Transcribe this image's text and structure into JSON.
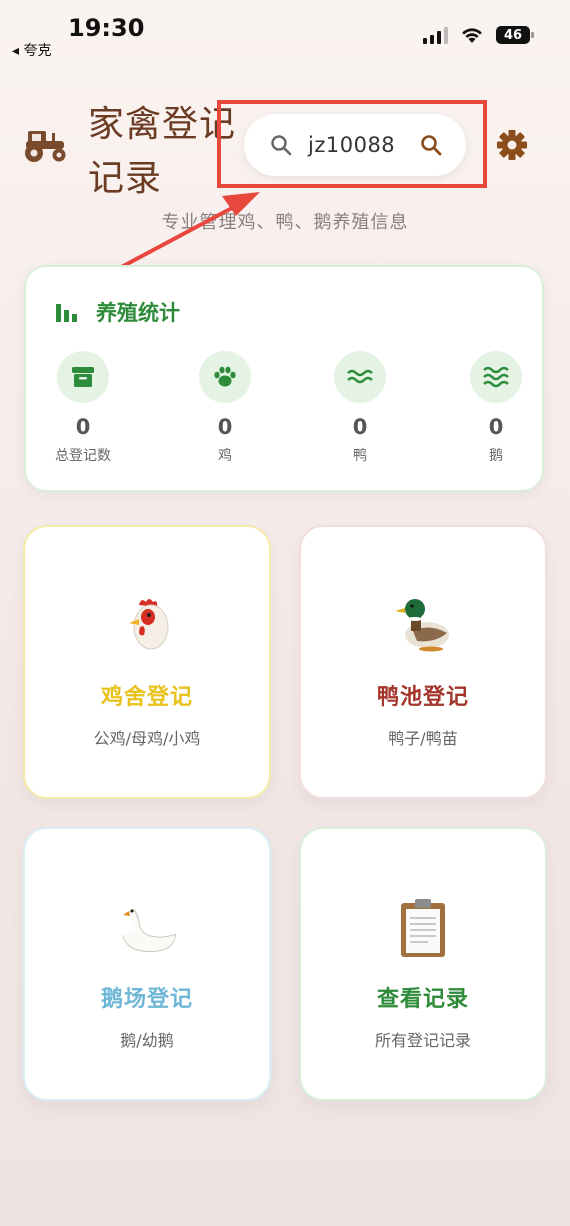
{
  "status": {
    "time": "19:30",
    "back_label": "◂ 夸克",
    "battery": "46"
  },
  "header": {
    "title": "家禽登记记录",
    "subtitle": "专业管理鸡、鸭、鹅养殖信息"
  },
  "search": {
    "value": "jz10088"
  },
  "stats": {
    "title": "养殖统计",
    "items": [
      {
        "value": "0",
        "label": "总登记数",
        "icon": "archive-box-icon"
      },
      {
        "value": "0",
        "label": "鸡",
        "icon": "paw-icon"
      },
      {
        "value": "0",
        "label": "鸭",
        "icon": "waves-icon"
      },
      {
        "value": "0",
        "label": "鹅",
        "icon": "water-waves-icon"
      }
    ]
  },
  "tiles": [
    {
      "title": "鸡舍登记",
      "subtitle": "公鸡/母鸡/小鸡",
      "icon": "rooster-icon",
      "color": "#e8c21a",
      "border": "#f6eaa9"
    },
    {
      "title": "鸭池登记",
      "subtitle": "鸭子/鸭苗",
      "icon": "duck-icon",
      "color": "#a3352b",
      "border": "#f2dede"
    },
    {
      "title": "鹅场登记",
      "subtitle": "鹅/幼鹅",
      "icon": "swan-icon",
      "color": "#6fb7d6",
      "border": "#d9eef5"
    },
    {
      "title": "查看记录",
      "subtitle": "所有登记记录",
      "icon": "clipboard-icon",
      "color": "#2e8b3a",
      "border": "#d9eed9"
    }
  ],
  "colors": {
    "accent_green": "#2e8b3a",
    "title_brown": "#6b3b24",
    "highlight_red": "#e8473e"
  }
}
